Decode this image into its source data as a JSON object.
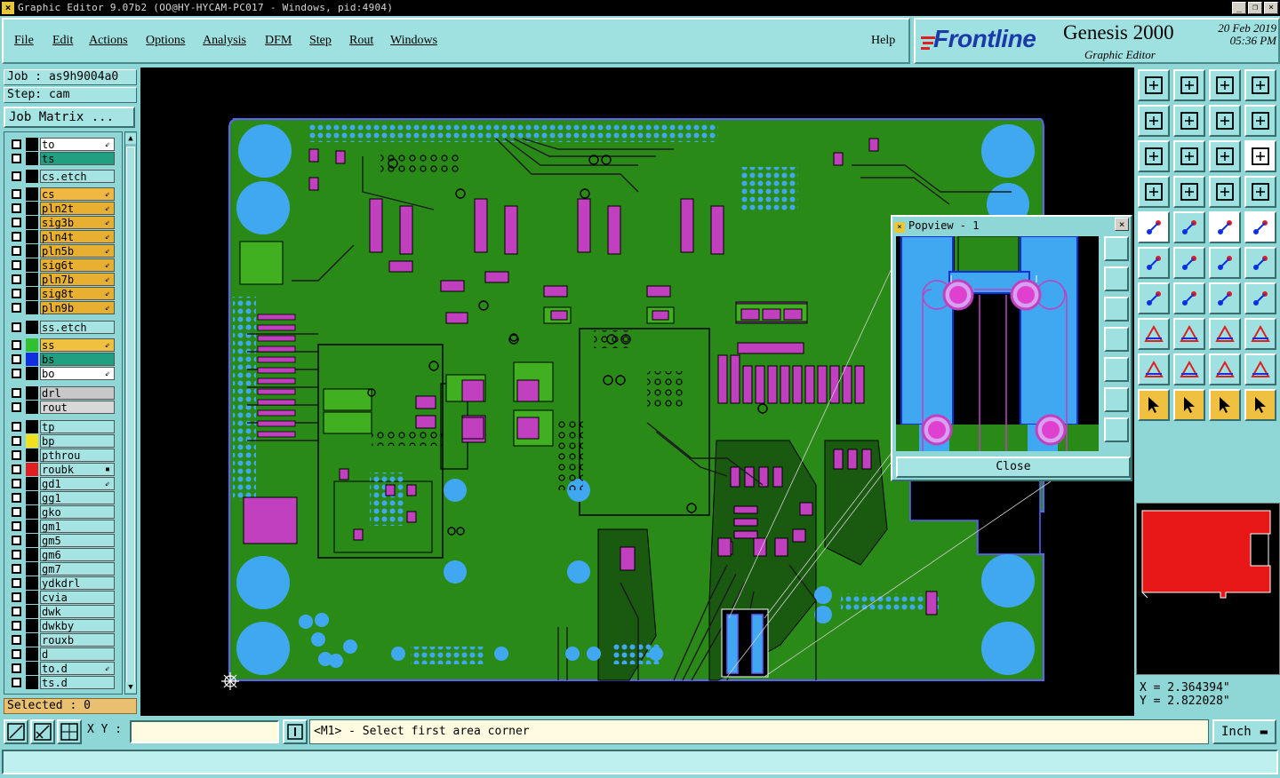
{
  "window": {
    "title": "Graphic Editor 9.07b2 (OO@HY-HYCAM-PC017 - Windows, pid:4904)"
  },
  "menu": {
    "items": [
      {
        "label": "File",
        "name": "menu-file"
      },
      {
        "label": "Edit",
        "name": "menu-edit"
      },
      {
        "label": "Actions",
        "name": "menu-actions"
      },
      {
        "label": "Options",
        "name": "menu-options"
      },
      {
        "label": "Analysis",
        "name": "menu-analysis"
      },
      {
        "label": "DFM",
        "name": "menu-dfm"
      },
      {
        "label": "Step",
        "name": "menu-step"
      },
      {
        "label": "Rout",
        "name": "menu-rout"
      },
      {
        "label": "Windows",
        "name": "menu-windows"
      }
    ],
    "help": "Help"
  },
  "brand": {
    "logo": "Frontline",
    "product": "Genesis 2000",
    "subtitle": "Graphic Editor",
    "date": "20 Feb 2019",
    "time": "05:36 PM"
  },
  "job": {
    "job_label": "Job : as9h9004a0",
    "step_label": "Step: cam",
    "matrix_button": "Job Matrix ..."
  },
  "layers": [
    {
      "name": "to",
      "color": "#ffffff",
      "swatch": "#000000",
      "flag": "⇙"
    },
    {
      "name": "ts",
      "color": "#20a080",
      "swatch": "#000000",
      "flag": ""
    },
    {
      "name": "cs.etch",
      "color": "#a6e4e4",
      "swatch": "#000000",
      "flag": ""
    },
    {
      "name": "cs",
      "color": "#f0b840",
      "swatch": "#000000",
      "flag": "⇙"
    },
    {
      "name": "pln2t",
      "color": "#e8b030",
      "swatch": "#000000",
      "flag": "⇙"
    },
    {
      "name": "sig3b",
      "color": "#e8b030",
      "swatch": "#000000",
      "flag": "⇙"
    },
    {
      "name": "pln4t",
      "color": "#e8b030",
      "swatch": "#000000",
      "flag": "⇙"
    },
    {
      "name": "pln5b",
      "color": "#e8b030",
      "swatch": "#000000",
      "flag": "⇙"
    },
    {
      "name": "sig6t",
      "color": "#e8b030",
      "swatch": "#000000",
      "flag": "⇙"
    },
    {
      "name": "pln7b",
      "color": "#e8b030",
      "swatch": "#000000",
      "flag": "⇙"
    },
    {
      "name": "sig8t",
      "color": "#e8b030",
      "swatch": "#000000",
      "flag": "⇙"
    },
    {
      "name": "pln9b",
      "color": "#e8b030",
      "swatch": "#000000",
      "flag": "⇙"
    },
    {
      "name": "ss.etch",
      "color": "#a6e4e4",
      "swatch": "#000000",
      "flag": ""
    },
    {
      "name": "ss",
      "color": "#f0c040",
      "swatch": "#30c030",
      "flag": "⇙"
    },
    {
      "name": "bs",
      "color": "#20a080",
      "swatch": "#1030e0",
      "flag": ""
    },
    {
      "name": "bo",
      "color": "#ffffff",
      "swatch": "#000000",
      "flag": "⇙"
    },
    {
      "name": "drl",
      "color": "#c8c8c8",
      "swatch": "#000000",
      "flag": ""
    },
    {
      "name": "rout",
      "color": "#d8d8d8",
      "swatch": "#000000",
      "flag": ""
    },
    {
      "name": "tp",
      "color": "#a6e4e4",
      "swatch": "#000000",
      "flag": ""
    },
    {
      "name": "bp",
      "color": "#a6e4e4",
      "swatch": "#f0e020",
      "flag": ""
    },
    {
      "name": "pthrou",
      "color": "#a6e4e4",
      "swatch": "#000000",
      "flag": ""
    },
    {
      "name": "roubk",
      "color": "#a6e4e4",
      "swatch": "#e02020",
      "flag": "▪"
    },
    {
      "name": "gd1",
      "color": "#a6e4e4",
      "swatch": "#000000",
      "flag": "⇙"
    },
    {
      "name": "gg1",
      "color": "#a6e4e4",
      "swatch": "#000000",
      "flag": ""
    },
    {
      "name": "gko",
      "color": "#a6e4e4",
      "swatch": "#000000",
      "flag": ""
    },
    {
      "name": "gm1",
      "color": "#a6e4e4",
      "swatch": "#000000",
      "flag": ""
    },
    {
      "name": "gm5",
      "color": "#a6e4e4",
      "swatch": "#000000",
      "flag": ""
    },
    {
      "name": "gm6",
      "color": "#a6e4e4",
      "swatch": "#000000",
      "flag": ""
    },
    {
      "name": "gm7",
      "color": "#a6e4e4",
      "swatch": "#000000",
      "flag": ""
    },
    {
      "name": "ydkdrl",
      "color": "#a6e4e4",
      "swatch": "#000000",
      "flag": ""
    },
    {
      "name": "cvia",
      "color": "#a6e4e4",
      "swatch": "#000000",
      "flag": ""
    },
    {
      "name": "dwk",
      "color": "#a6e4e4",
      "swatch": "#000000",
      "flag": ""
    },
    {
      "name": "dwkby",
      "color": "#a6e4e4",
      "swatch": "#000000",
      "flag": ""
    },
    {
      "name": "rouxb",
      "color": "#a6e4e4",
      "swatch": "#000000",
      "flag": ""
    },
    {
      "name": "d",
      "color": "#a6e4e4",
      "swatch": "#000000",
      "flag": ""
    },
    {
      "name": "to.d",
      "color": "#a6e4e4",
      "swatch": "#000000",
      "flag": "⇙"
    },
    {
      "name": "ts.d",
      "color": "#a6e4e4",
      "swatch": "#000000",
      "flag": ""
    }
  ],
  "selected": "Selected : 0",
  "popview": {
    "title": "Popview - 1",
    "close": "Close"
  },
  "coords": {
    "x": "X = 2.364394\"",
    "y": "Y = 2.822028\""
  },
  "status": {
    "xy_label": "X Y :",
    "xy_value": "",
    "message": "<M1> - Select first area corner",
    "unit": "Inch"
  },
  "colors": {
    "board": "#2a8a18",
    "pad": "#c040c0",
    "copper": "#40a8f0",
    "outline": "#6060ff",
    "ui": "#8fd6d6"
  }
}
